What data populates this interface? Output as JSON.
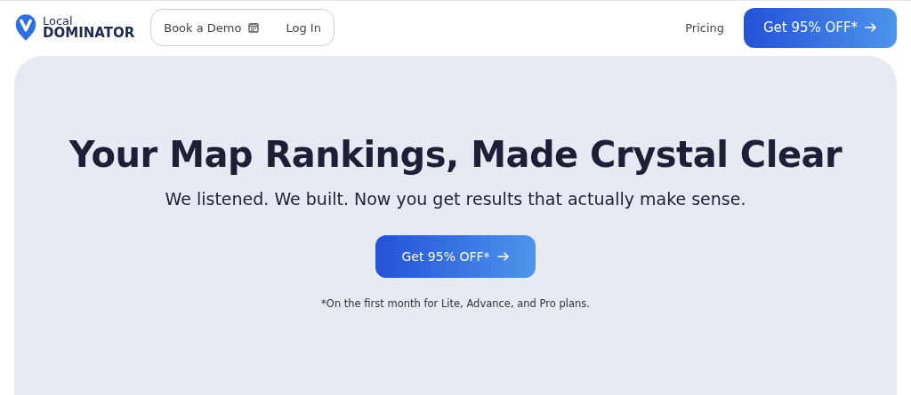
{
  "logo": {
    "top": "Local",
    "bottom": "DOMINATOR"
  },
  "nav_group": [
    {
      "label": "Book a Demo",
      "kind": "dated"
    },
    {
      "label": "Log In",
      "kind": "plain"
    }
  ],
  "nav_link": "Pricing",
  "header_cta": "Get 95% OFF*",
  "hero": {
    "title": "Your Map Rankings, Made Crystal Clear",
    "subtitle": "We listened. We built. Now you get results that actually make sense.",
    "cta": "Get 95% OFF*",
    "footnote": "*On the first month for Lite, Advance, and Pro plans."
  }
}
